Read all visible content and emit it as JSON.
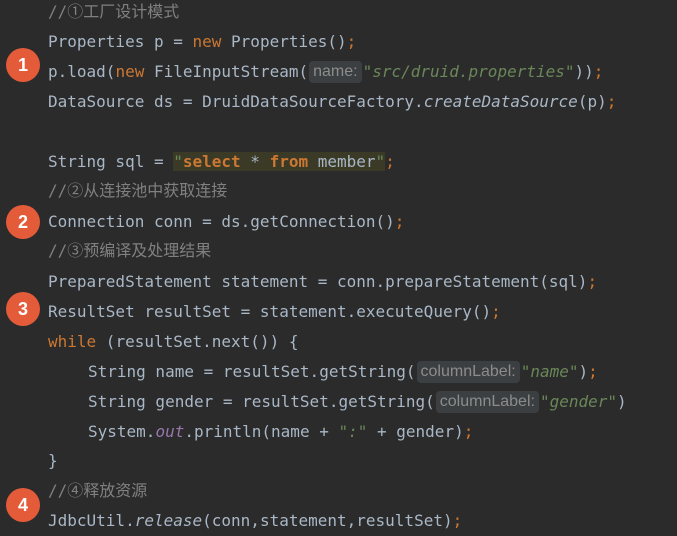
{
  "badges": [
    "1",
    "2",
    "3",
    "4"
  ],
  "code": {
    "c1": "//①工厂设计模式",
    "l1": {
      "a": "Properties p = ",
      "kw": "new",
      "b": " Properties()",
      "semi": ";"
    },
    "l2": {
      "a": "p.load(",
      "kw": "new",
      "b": " FileInputStream(",
      "hint": "name:",
      "str": "\"src/druid.properties\"",
      "c": "))",
      "semi": ";"
    },
    "l3": {
      "a": "DataSource ds = DruidDataSourceFactory.",
      "it": "createDataSource",
      "b": "(p)",
      "semi": ";"
    },
    "l4": {
      "a": "String sql = ",
      "q1": "\"",
      "k1": "select",
      "t1": " * ",
      "k2": "from",
      "t2": " member",
      "q2": "\"",
      "semi": ";"
    },
    "c2": "//②从连接池中获取连接",
    "l5": {
      "a": "Connection conn = ds.getConnection()",
      "semi": ";"
    },
    "c3": "//③预编译及处理结果",
    "l6": {
      "a": "PreparedStatement statement = conn.prepareStatement(sql)",
      "semi": ";"
    },
    "l7": {
      "a": "ResultSet resultSet = statement.executeQuery()",
      "semi": ";"
    },
    "l8": {
      "kw": "while",
      "a": " (resultSet.next()) {"
    },
    "l9": {
      "a": "String name = resultSet.getString(",
      "hint": "columnLabel:",
      "str": "\"name\"",
      "b": ")",
      "semi": ";"
    },
    "l10": {
      "a": "String gender = resultSet.getString(",
      "hint": "columnLabel:",
      "str": "\"gender\"",
      "b": ")"
    },
    "l11": {
      "a": "System.",
      "fld": "out",
      "b": ".println(name + ",
      "str": "\":\"",
      "c": " + gender)",
      "semi": ";"
    },
    "l12": {
      "a": "}"
    },
    "c4": "//④释放资源",
    "l13": {
      "a": "JdbcUtil.",
      "it": "release",
      "b": "(conn,statement,resultSet)",
      "semi": ";"
    }
  }
}
